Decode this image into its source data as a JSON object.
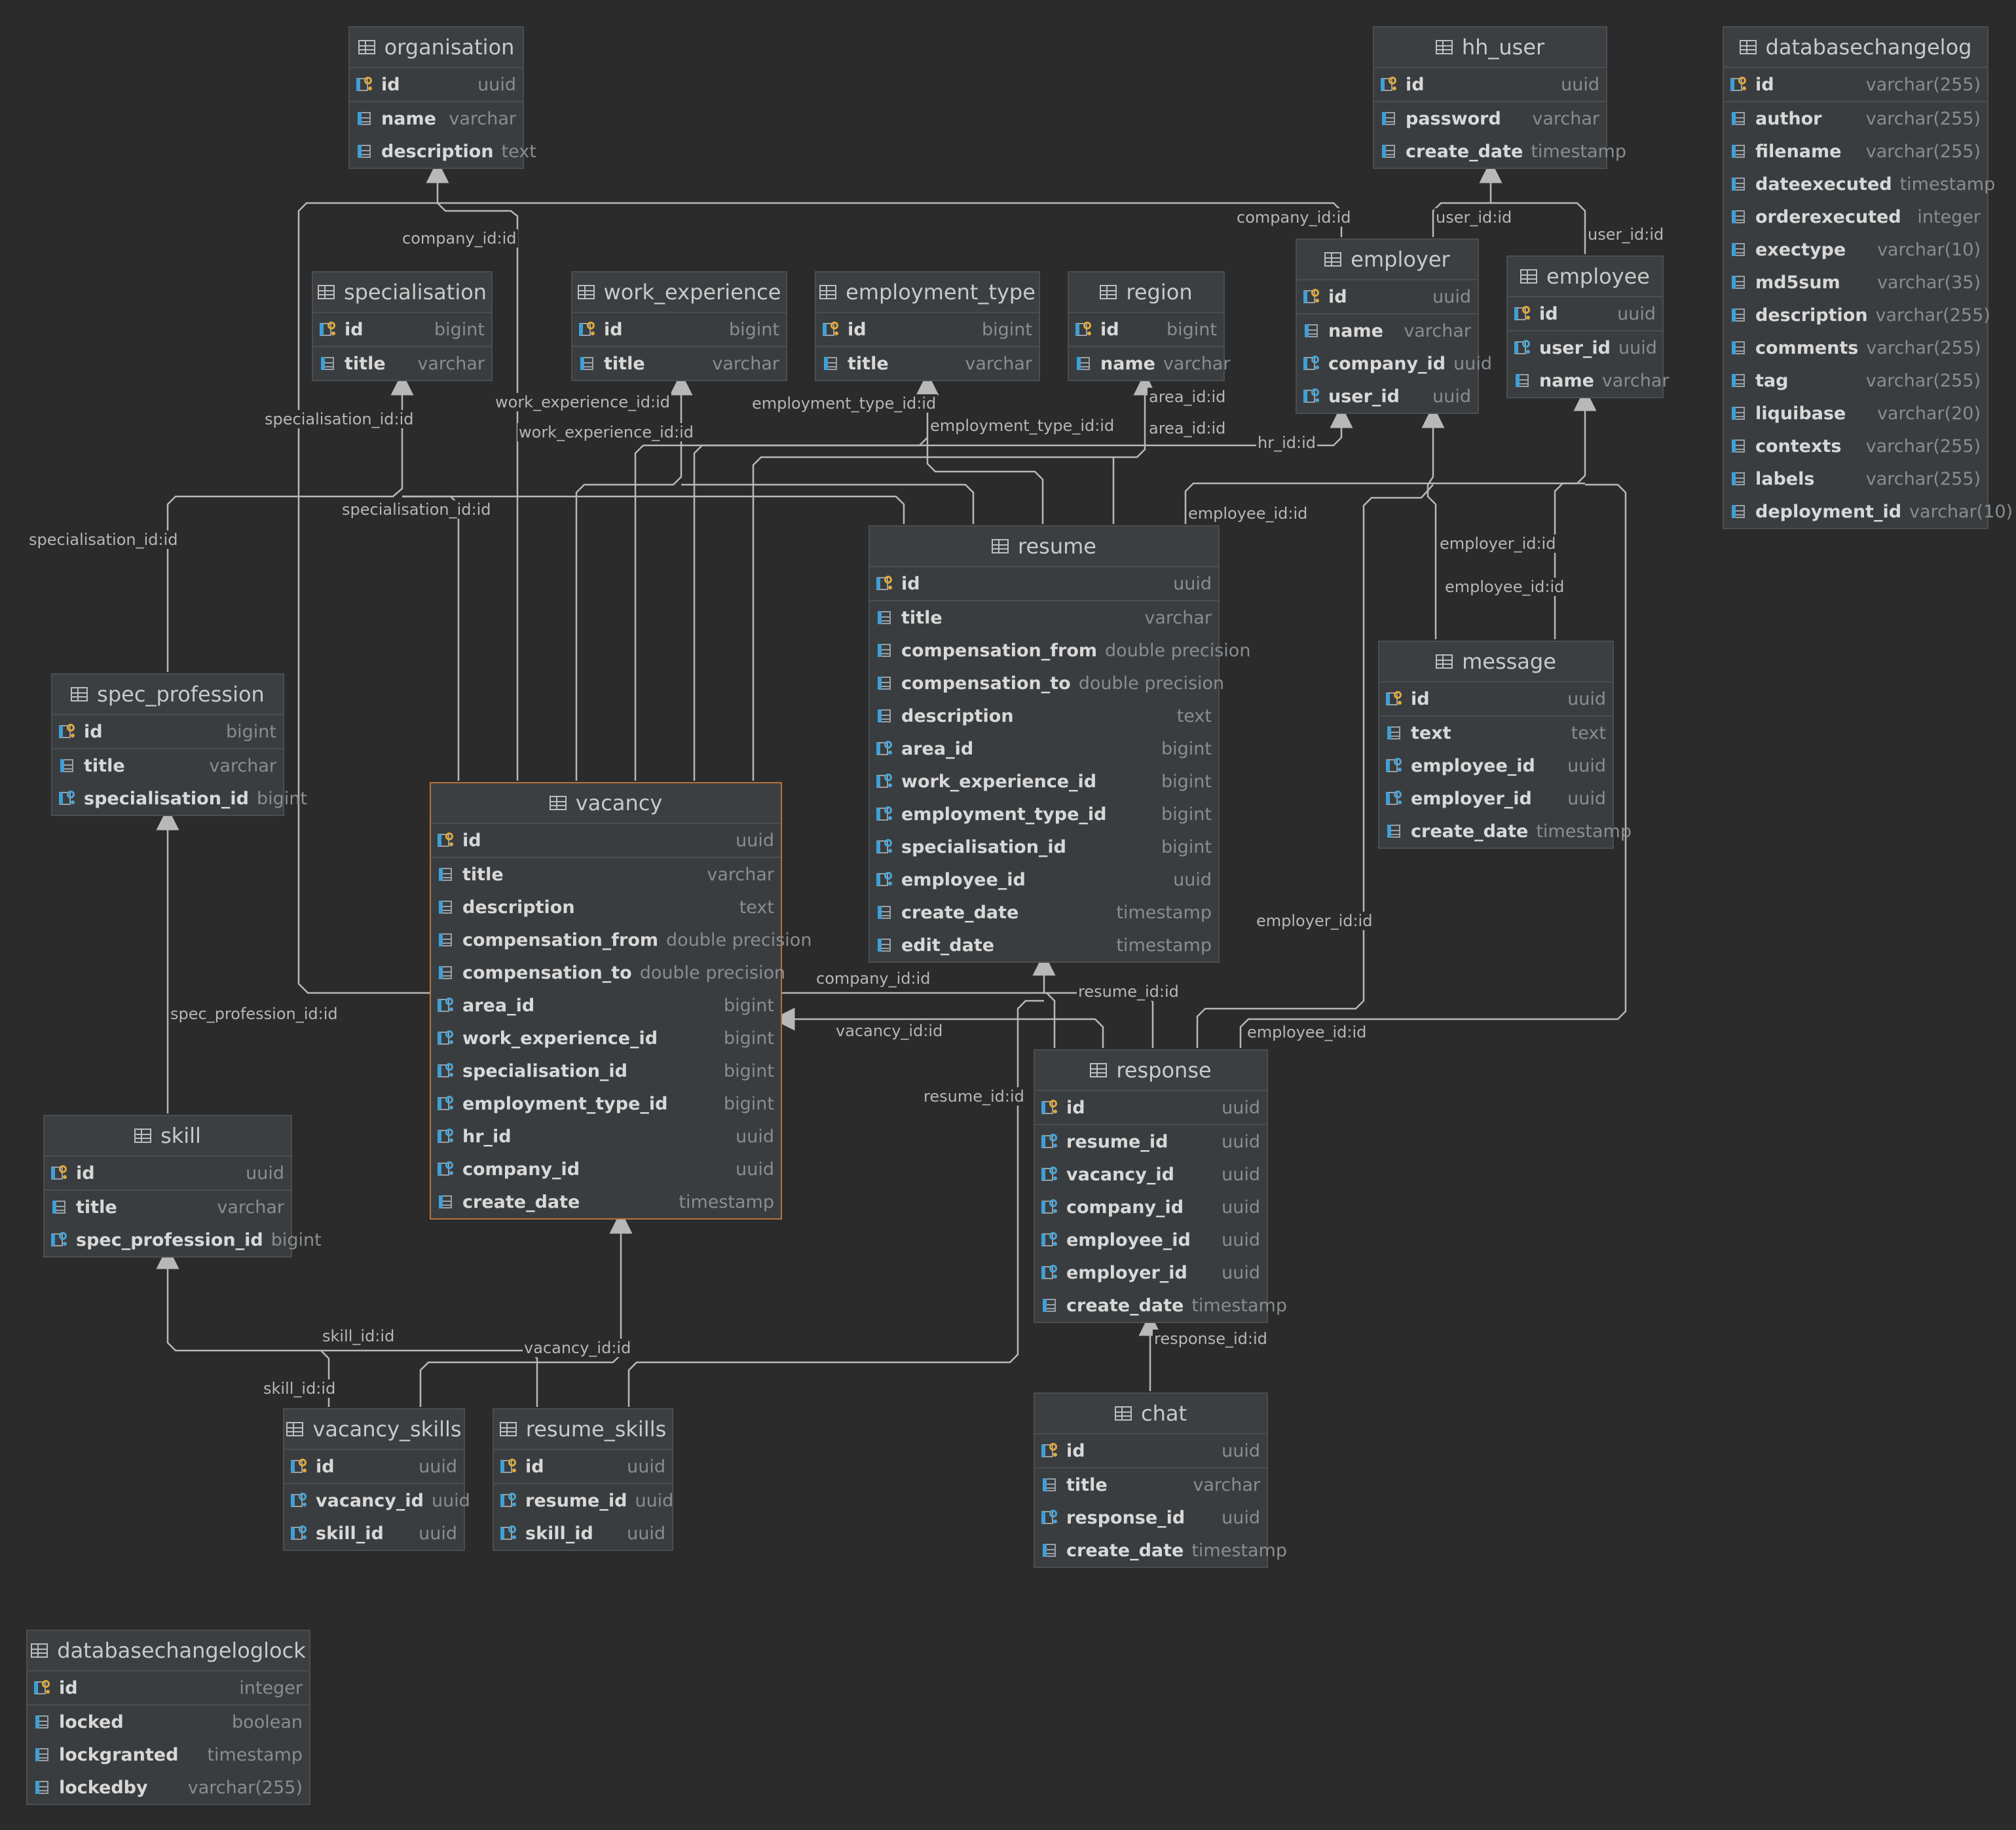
{
  "tables": [
    {
      "key": "organisation",
      "name": "organisation",
      "columns": [
        [
          "pk",
          "id",
          "uuid"
        ],
        [
          "col",
          "name",
          "varchar"
        ],
        [
          "col",
          "description",
          "text"
        ]
      ]
    },
    {
      "key": "hh_user",
      "name": "hh_user",
      "columns": [
        [
          "pk",
          "id",
          "uuid"
        ],
        [
          "col",
          "password",
          "varchar"
        ],
        [
          "col",
          "create_date",
          "timestamp"
        ]
      ]
    },
    {
      "key": "databasechangelog",
      "name": "databasechangelog",
      "columns": [
        [
          "pk",
          "id",
          "varchar(255)"
        ],
        [
          "col",
          "author",
          "varchar(255)"
        ],
        [
          "col",
          "filename",
          "varchar(255)"
        ],
        [
          "col",
          "dateexecuted",
          "timestamp"
        ],
        [
          "col",
          "orderexecuted",
          "integer"
        ],
        [
          "col",
          "exectype",
          "varchar(10)"
        ],
        [
          "col",
          "md5sum",
          "varchar(35)"
        ],
        [
          "col",
          "description",
          "varchar(255)"
        ],
        [
          "col",
          "comments",
          "varchar(255)"
        ],
        [
          "col",
          "tag",
          "varchar(255)"
        ],
        [
          "col",
          "liquibase",
          "varchar(20)"
        ],
        [
          "col",
          "contexts",
          "varchar(255)"
        ],
        [
          "col",
          "labels",
          "varchar(255)"
        ],
        [
          "col",
          "deployment_id",
          "varchar(10)"
        ]
      ]
    },
    {
      "key": "specialisation",
      "name": "specialisation",
      "columns": [
        [
          "pk",
          "id",
          "bigint"
        ],
        [
          "col",
          "title",
          "varchar"
        ]
      ]
    },
    {
      "key": "work_experience",
      "name": "work_experience",
      "columns": [
        [
          "pk",
          "id",
          "bigint"
        ],
        [
          "col",
          "title",
          "varchar"
        ]
      ]
    },
    {
      "key": "employment_type",
      "name": "employment_type",
      "columns": [
        [
          "pk",
          "id",
          "bigint"
        ],
        [
          "col",
          "title",
          "varchar"
        ]
      ]
    },
    {
      "key": "region",
      "name": "region",
      "columns": [
        [
          "pk",
          "id",
          "bigint"
        ],
        [
          "col",
          "name",
          "varchar"
        ]
      ]
    },
    {
      "key": "employer",
      "name": "employer",
      "columns": [
        [
          "pk",
          "id",
          "uuid"
        ],
        [
          "col",
          "name",
          "varchar"
        ],
        [
          "fk",
          "company_id",
          "uuid"
        ],
        [
          "fk",
          "user_id",
          "uuid"
        ]
      ]
    },
    {
      "key": "employee",
      "name": "employee",
      "columns": [
        [
          "pk",
          "id",
          "uuid"
        ],
        [
          "fk",
          "user_id",
          "uuid"
        ],
        [
          "col",
          "name",
          "varchar"
        ]
      ]
    },
    {
      "key": "resume",
      "name": "resume",
      "columns": [
        [
          "pk",
          "id",
          "uuid"
        ],
        [
          "col",
          "title",
          "varchar"
        ],
        [
          "col",
          "compensation_from",
          "double precision"
        ],
        [
          "col",
          "compensation_to",
          "double precision"
        ],
        [
          "col",
          "description",
          "text"
        ],
        [
          "fk",
          "area_id",
          "bigint"
        ],
        [
          "fk",
          "work_experience_id",
          "bigint"
        ],
        [
          "fk",
          "employment_type_id",
          "bigint"
        ],
        [
          "fk",
          "specialisation_id",
          "bigint"
        ],
        [
          "fk",
          "employee_id",
          "uuid"
        ],
        [
          "col",
          "create_date",
          "timestamp"
        ],
        [
          "col",
          "edit_date",
          "timestamp"
        ]
      ]
    },
    {
      "key": "message",
      "name": "message",
      "columns": [
        [
          "pk",
          "id",
          "uuid"
        ],
        [
          "col",
          "text",
          "text"
        ],
        [
          "fk",
          "employee_id",
          "uuid"
        ],
        [
          "fk",
          "employer_id",
          "uuid"
        ],
        [
          "col",
          "create_date",
          "timestamp"
        ]
      ]
    },
    {
      "key": "spec_profession",
      "name": "spec_profession",
      "columns": [
        [
          "pk",
          "id",
          "bigint"
        ],
        [
          "col",
          "title",
          "varchar"
        ],
        [
          "fk",
          "specialisation_id",
          "bigint"
        ]
      ]
    },
    {
      "key": "vacancy",
      "name": "vacancy",
      "columns": [
        [
          "pk",
          "id",
          "uuid"
        ],
        [
          "col",
          "title",
          "varchar"
        ],
        [
          "col",
          "description",
          "text"
        ],
        [
          "col",
          "compensation_from",
          "double precision"
        ],
        [
          "col",
          "compensation_to",
          "double precision"
        ],
        [
          "fk",
          "area_id",
          "bigint"
        ],
        [
          "fk",
          "work_experience_id",
          "bigint"
        ],
        [
          "fk",
          "specialisation_id",
          "bigint"
        ],
        [
          "fk",
          "employment_type_id",
          "bigint"
        ],
        [
          "fk",
          "hr_id",
          "uuid"
        ],
        [
          "fk",
          "company_id",
          "uuid"
        ],
        [
          "col",
          "create_date",
          "timestamp"
        ]
      ]
    },
    {
      "key": "response",
      "name": "response",
      "columns": [
        [
          "pk",
          "id",
          "uuid"
        ],
        [
          "fk",
          "resume_id",
          "uuid"
        ],
        [
          "fk",
          "vacancy_id",
          "uuid"
        ],
        [
          "fk",
          "company_id",
          "uuid"
        ],
        [
          "fk",
          "employee_id",
          "uuid"
        ],
        [
          "fk",
          "employer_id",
          "uuid"
        ],
        [
          "col",
          "create_date",
          "timestamp"
        ]
      ]
    },
    {
      "key": "skill",
      "name": "skill",
      "columns": [
        [
          "pk",
          "id",
          "uuid"
        ],
        [
          "col",
          "title",
          "varchar"
        ],
        [
          "fk",
          "spec_profession_id",
          "bigint"
        ]
      ]
    },
    {
      "key": "vacancy_skills",
      "name": "vacancy_skills",
      "columns": [
        [
          "pk",
          "id",
          "uuid"
        ],
        [
          "fk",
          "vacancy_id",
          "uuid"
        ],
        [
          "fk",
          "skill_id",
          "uuid"
        ]
      ]
    },
    {
      "key": "resume_skills",
      "name": "resume_skills",
      "columns": [
        [
          "pk",
          "id",
          "uuid"
        ],
        [
          "fk",
          "resume_id",
          "uuid"
        ],
        [
          "fk",
          "skill_id",
          "uuid"
        ]
      ]
    },
    {
      "key": "chat",
      "name": "chat",
      "columns": [
        [
          "pk",
          "id",
          "uuid"
        ],
        [
          "col",
          "title",
          "varchar"
        ],
        [
          "fk",
          "response_id",
          "uuid"
        ],
        [
          "col",
          "create_date",
          "timestamp"
        ]
      ]
    },
    {
      "key": "databasechangeloglock",
      "name": "databasechangeloglock",
      "columns": [
        [
          "pk",
          "id",
          "integer"
        ],
        [
          "col",
          "locked",
          "boolean"
        ],
        [
          "col",
          "lockgranted",
          "timestamp"
        ],
        [
          "col",
          "lockedby",
          "varchar(255)"
        ]
      ]
    }
  ],
  "link_labels": [
    "company_id:id",
    "company_id:id",
    "user_id:id",
    "user_id:id",
    "specialisation_id:id",
    "work_experience_id:id",
    "work_experience_id:id",
    "employment_type_id:id",
    "employment_type_id:id",
    "area_id:id",
    "area_id:id",
    "hr_id:id",
    "specialisation_id:id",
    "specialisation_id:id",
    "employee_id:id",
    "employer_id:id",
    "employee_id:id",
    "employer_id:id",
    "company_id:id",
    "resume_id:id",
    "vacancy_id:id",
    "employee_id:id",
    "resume_id:id",
    "spec_profession_id:id",
    "response_id:id",
    "skill_id:id",
    "vacancy_id:id",
    "skill_id:id"
  ],
  "colors": {
    "background": "#2b2b2b",
    "table": "#3a3d3f",
    "selected_border": "#b8723b",
    "pk_key": "#e0a93a",
    "fk_key": "#48a6d8",
    "line": "#b8b8b8"
  }
}
